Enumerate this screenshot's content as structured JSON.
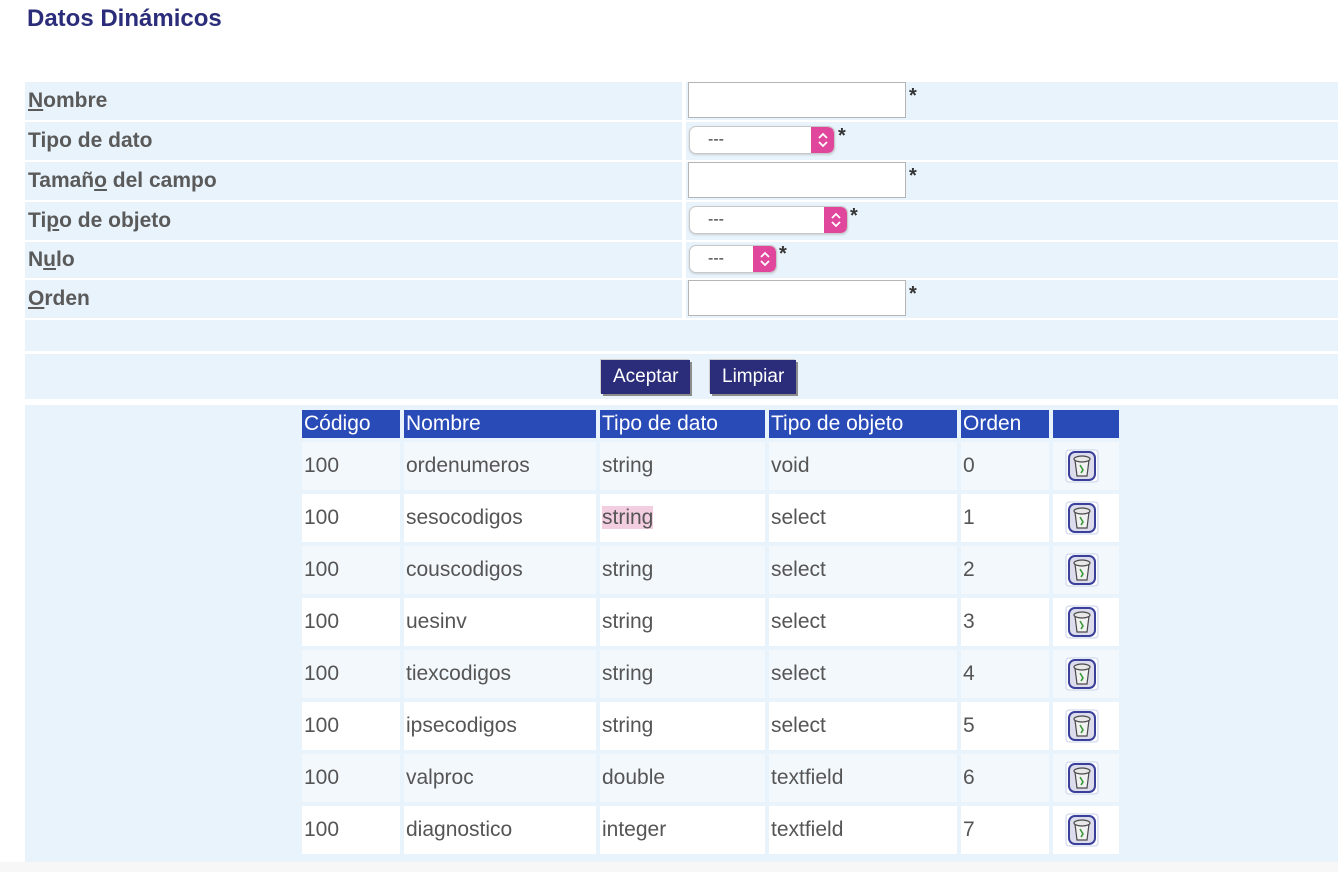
{
  "page": {
    "title": "Datos Dinámicos"
  },
  "form": {
    "required_mark": "*",
    "nombre": {
      "label_ul": "N",
      "label_rest": "ombre",
      "value": ""
    },
    "tipo_dato": {
      "label": "Tipo de dato",
      "selected": "---"
    },
    "tamano": {
      "label_a": "Tamañ",
      "label_ul": "o",
      "label_b": " del campo",
      "value": ""
    },
    "tipo_objeto": {
      "label_a": "Ti",
      "label_ul": "p",
      "label_b": "o de objeto",
      "selected": "---"
    },
    "nulo": {
      "label_a": "N",
      "label_ul": "u",
      "label_b": "lo",
      "selected": "---"
    },
    "orden": {
      "label_ul": "O",
      "label_rest": "rden",
      "value": ""
    }
  },
  "buttons": {
    "accept": "Aceptar",
    "clear": "Limpiar"
  },
  "table": {
    "headers": [
      "Código",
      "Nombre",
      "Tipo de dato",
      "Tipo de objeto",
      "Orden",
      ""
    ],
    "rows": [
      {
        "codigo": "100",
        "nombre": "ordenumeros",
        "tipo_dato": "string",
        "tipo_objeto": "void",
        "orden": "0"
      },
      {
        "codigo": "100",
        "nombre": "sesocodigos",
        "tipo_dato": "string",
        "tipo_objeto": "select",
        "orden": "1"
      },
      {
        "codigo": "100",
        "nombre": "couscodigos",
        "tipo_dato": "string",
        "tipo_objeto": "select",
        "orden": "2"
      },
      {
        "codigo": "100",
        "nombre": "uesinv",
        "tipo_dato": "string",
        "tipo_objeto": "select",
        "orden": "3"
      },
      {
        "codigo": "100",
        "nombre": "tiexcodigos",
        "tipo_dato": "string",
        "tipo_objeto": "select",
        "orden": "4"
      },
      {
        "codigo": "100",
        "nombre": "ipsecodigos",
        "tipo_dato": "string",
        "tipo_objeto": "select",
        "orden": "5"
      },
      {
        "codigo": "100",
        "nombre": "valproc",
        "tipo_dato": "double",
        "tipo_objeto": "textfield",
        "orden": "6"
      },
      {
        "codigo": "100",
        "nombre": "diagnostico",
        "tipo_dato": "integer",
        "tipo_objeto": "textfield",
        "orden": "7"
      }
    ],
    "row_action_icon": "trash-icon"
  },
  "colors": {
    "title": "#2b2d7a",
    "panel_bg": "#e8f3fc",
    "header_bg": "#284bb8",
    "button_bg": "#2b2d7a",
    "select_accent": "#e0469c",
    "highlight": "#f3cde0"
  }
}
